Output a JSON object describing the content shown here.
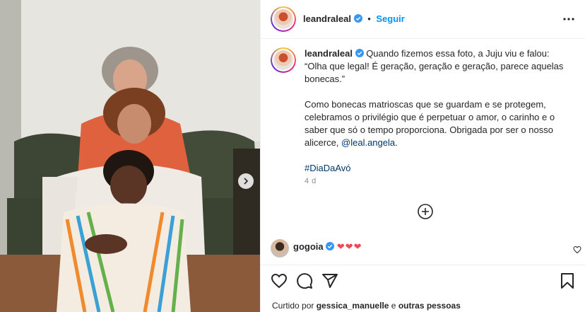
{
  "post": {
    "username": "leandraleal",
    "follow_label": "Seguir",
    "dot": "•",
    "caption_author": "leandraleal",
    "caption_p1": "Quando fizemos essa foto, a Juju viu e falou: “Olha que legal! É geração, geração e geração, parece aquelas bonecas.”",
    "caption_p2_text": "Como bonecas matrioscas que se guardam e se protegem, celebramos o privilégio que é perpetuar o amor, o carinho e o saber que só o tempo proporciona. Obrigada por ser o nosso alicerce, ",
    "caption_mention": "@leal.angela",
    "caption_p2_end": ".",
    "hashtag": "#DiaDaAvó",
    "timestamp": "4 d"
  },
  "comment": {
    "username": "gogoia",
    "hearts": "❤❤❤"
  },
  "likes": {
    "prefix": "Curtido por",
    "user": "gessica_manuelle",
    "middle": "e",
    "suffix": "outras pessoas"
  },
  "colors": {
    "accent": "#0095f6",
    "verified": "#3897f0",
    "heart": "#ed4956",
    "link": "#00376b"
  },
  "icons": [
    "verified-badge-icon",
    "more-options-icon",
    "chevron-right-icon",
    "load-more-comments-icon",
    "heart-icon",
    "comment-icon",
    "share-icon",
    "save-icon"
  ]
}
